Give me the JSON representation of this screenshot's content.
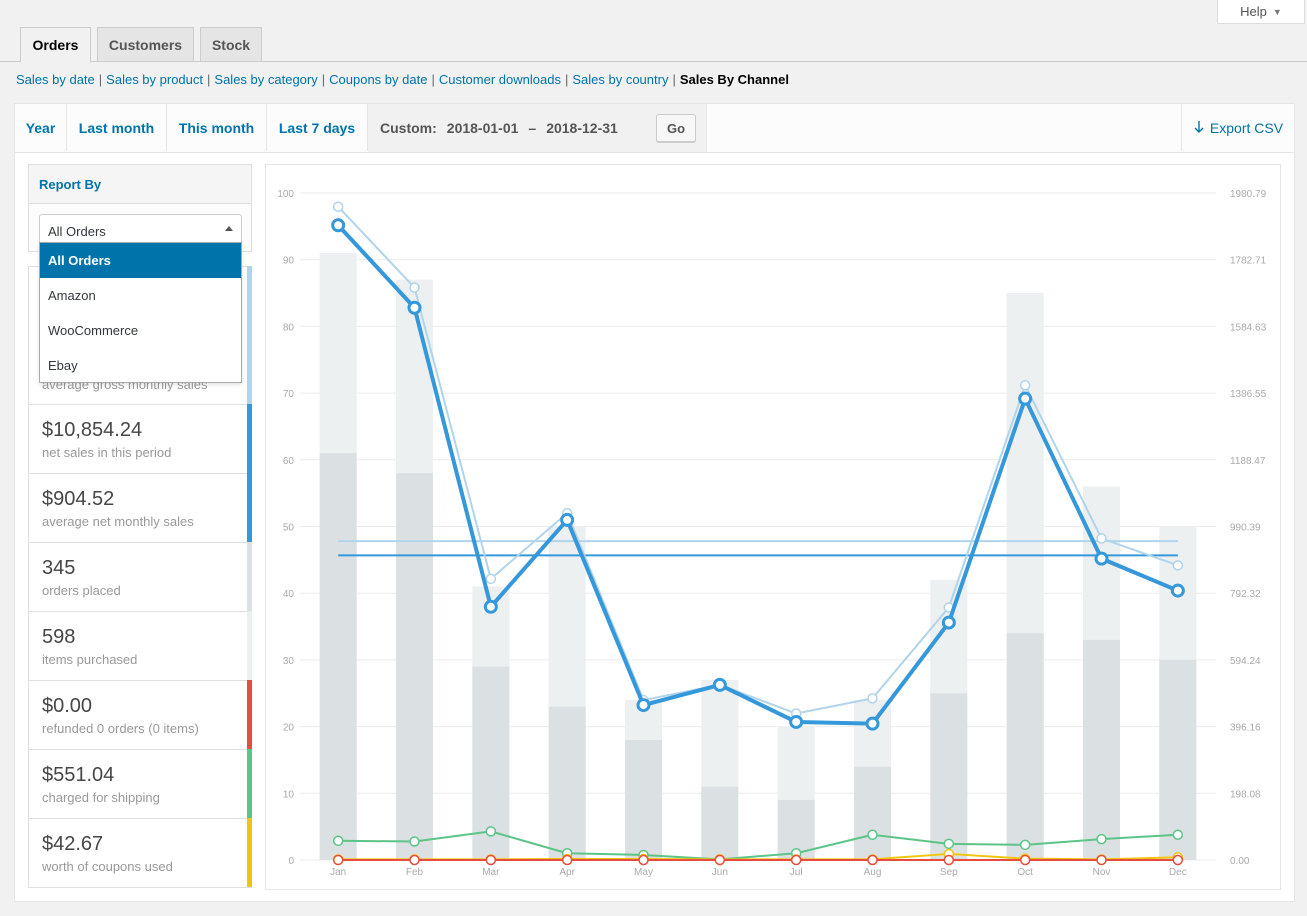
{
  "help": {
    "label": "Help",
    "caret": "▼"
  },
  "tabs": [
    {
      "label": "Orders",
      "active": true
    },
    {
      "label": "Customers",
      "active": false
    },
    {
      "label": "Stock",
      "active": false
    }
  ],
  "sub_links": [
    "Sales by date",
    "Sales by product",
    "Sales by category",
    "Coupons by date",
    "Customer downloads",
    "Sales by country"
  ],
  "sub_current": "Sales By Channel",
  "ranges": [
    "Year",
    "Last month",
    "This month",
    "Last 7 days"
  ],
  "custom": {
    "label": "Custom:",
    "from": "2018-01-01",
    "dash": "–",
    "to": "2018-12-31",
    "go": "Go"
  },
  "export": {
    "label": "Export CSV",
    "icon": "download-arrow-icon"
  },
  "report_by": {
    "title": "Report By",
    "selected": "All Orders",
    "options": [
      "All Orders",
      "Amazon",
      "WooCommerce",
      "Ebay"
    ]
  },
  "legend": [
    {
      "amount": "",
      "desc": "average gross monthly sales",
      "color": "#b1d4ea"
    },
    {
      "amount": "$10,854.24",
      "desc": "net sales in this period",
      "color": "#3498db"
    },
    {
      "amount": "$904.52",
      "desc": "average net monthly sales",
      "color": "#3498db"
    },
    {
      "amount": "345",
      "desc": "orders placed",
      "color": "#dbe1e3"
    },
    {
      "amount": "598",
      "desc": "items purchased",
      "color": "#ecf0f1"
    },
    {
      "amount": "$0.00",
      "desc": "refunded 0 orders (0 items)",
      "color": "#e74c3c"
    },
    {
      "amount": "$551.04",
      "desc": "charged for shipping",
      "color": "#5cc488"
    },
    {
      "amount": "$42.67",
      "desc": "worth of coupons used",
      "color": "#f1c40f"
    }
  ],
  "chart_data": {
    "type": "bar",
    "categories": [
      "Jan",
      "Feb",
      "Mar",
      "Apr",
      "May",
      "Jun",
      "Jul",
      "Aug",
      "Sep",
      "Oct",
      "Nov",
      "Dec"
    ],
    "y_left_ticks": [
      "0",
      "10",
      "20",
      "30",
      "40",
      "50",
      "60",
      "70",
      "80",
      "90",
      "100"
    ],
    "y_right_ticks": [
      "0.00",
      "198.08",
      "396.16",
      "594.24",
      "792.32",
      "990.39",
      "1188.47",
      "1386.55",
      "1584.63",
      "1782.71",
      "1980.79"
    ],
    "ylim_left": [
      0,
      100
    ],
    "ylim_right": [
      0,
      1980.79
    ],
    "grid": true,
    "series": [
      {
        "name": "items purchased",
        "kind": "bar",
        "axis": "left",
        "color": "#ecf0f1",
        "values": [
          91,
          87,
          41,
          50,
          24,
          27,
          20,
          24,
          42,
          85,
          56,
          50
        ]
      },
      {
        "name": "orders placed",
        "kind": "bar",
        "axis": "left",
        "color": "#dbe1e3",
        "values": [
          61,
          58,
          29,
          23,
          18,
          11,
          9,
          14,
          25,
          34,
          33,
          30
        ]
      },
      {
        "name": "gross sales amount",
        "kind": "line",
        "axis": "right",
        "color": "#b1d4ea",
        "values": [
          1940,
          1700,
          835,
          1030,
          475,
          520,
          435,
          480,
          750,
          1410,
          955,
          875
        ]
      },
      {
        "name": "net sales amount",
        "kind": "line",
        "axis": "right",
        "color": "#3498db",
        "values": [
          1885,
          1640,
          752,
          1010,
          460,
          520,
          410,
          405,
          705,
          1370,
          895,
          800
        ]
      },
      {
        "name": "shipping amount",
        "kind": "line",
        "axis": "right",
        "color": "#5cc488",
        "values": [
          57,
          55,
          85,
          20,
          15,
          2,
          20,
          75,
          48,
          45,
          62,
          75
        ]
      },
      {
        "name": "coupon amount",
        "kind": "line",
        "axis": "right",
        "color": "#f1c40f",
        "values": [
          2,
          2,
          2,
          3,
          3,
          2,
          2,
          2,
          18,
          4,
          2,
          8
        ]
      },
      {
        "name": "refund amount",
        "kind": "line",
        "axis": "right",
        "color": "#e74c3c",
        "values": [
          0,
          0,
          0,
          0,
          0,
          0,
          0,
          0,
          0,
          0,
          0,
          0
        ]
      },
      {
        "name": "average gross sales",
        "kind": "hline",
        "axis": "right",
        "color": "#b1d4ea",
        "values": [
          947
        ]
      },
      {
        "name": "average net sales",
        "kind": "hline",
        "axis": "right",
        "color": "#3498db",
        "values": [
          904.52
        ]
      }
    ]
  }
}
